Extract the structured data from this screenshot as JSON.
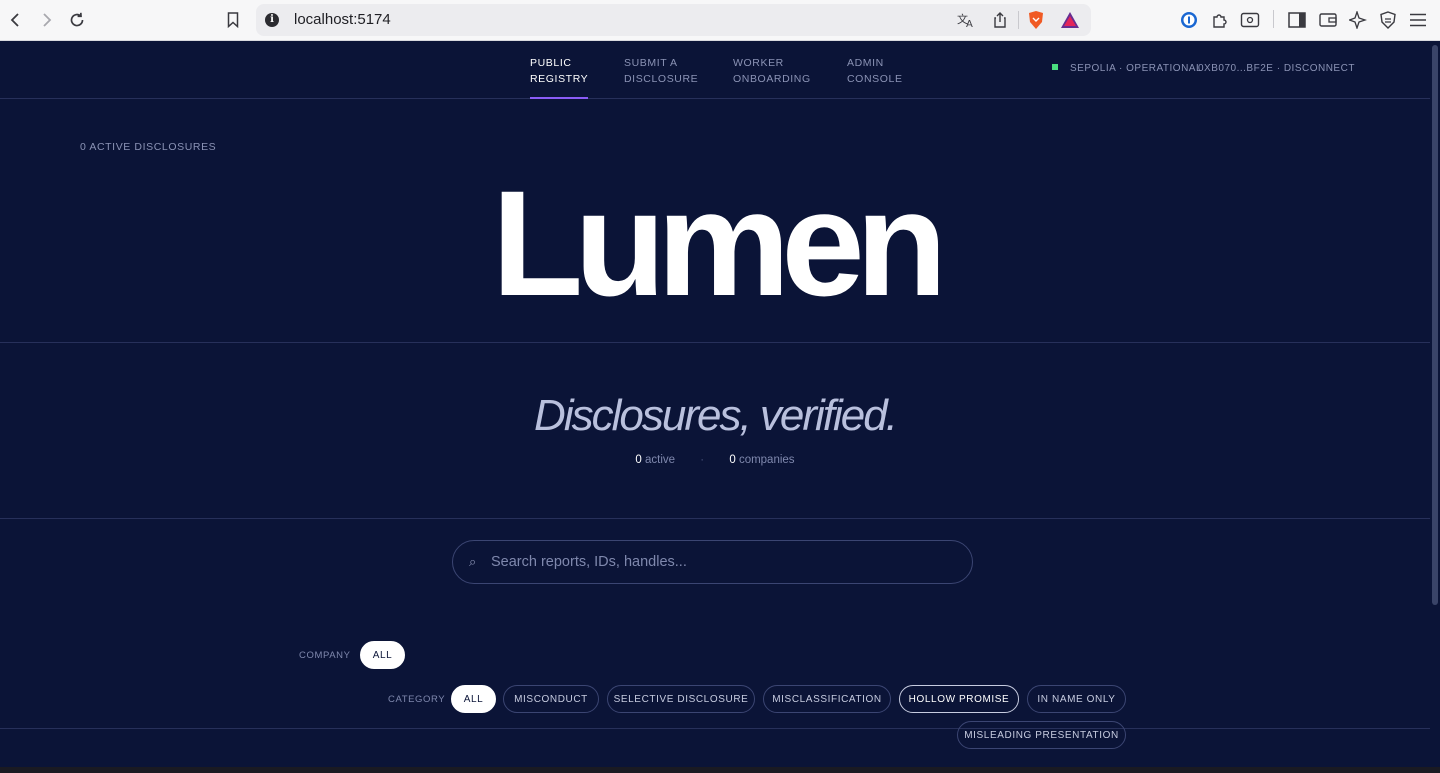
{
  "browser": {
    "url": "localhost:5174"
  },
  "nav": {
    "items": [
      {
        "line1": "PUBLIC",
        "line2": "REGISTRY"
      },
      {
        "line1": "SUBMIT A",
        "line2": "DISCLOSURE"
      },
      {
        "line1": "WORKER",
        "line2": "ONBOARDING"
      },
      {
        "line1": "ADMIN",
        "line2": "CONSOLE"
      }
    ],
    "network_status": "SEPOLIA · OPERATIONAL",
    "wallet": "0XB070...BF2E · DISCONNECT"
  },
  "hero": {
    "count_label": "0 ACTIVE DISCLOSURES",
    "brand": "Lumen"
  },
  "tagline": {
    "text": "Disclosures, verified.",
    "active_count": "0",
    "active_label": "active",
    "separator": "·",
    "companies_count": "0",
    "companies_label": "companies"
  },
  "search": {
    "icon_glyph": "⌕",
    "placeholder": "Search reports, IDs, handles..."
  },
  "filters": {
    "company_label": "COMPANY",
    "company_options": [
      "ALL"
    ],
    "category_label": "CATEGORY",
    "category_options": [
      "ALL",
      "MISCONDUCT",
      "SELECTIVE DISCLOSURE",
      "MISCLASSIFICATION",
      "HOLLOW PROMISE",
      "IN NAME ONLY",
      "MISLEADING PRESENTATION"
    ]
  },
  "colors": {
    "background": "#0b1437",
    "accent": "#8a5cf6",
    "status_ok": "#4ade80"
  }
}
